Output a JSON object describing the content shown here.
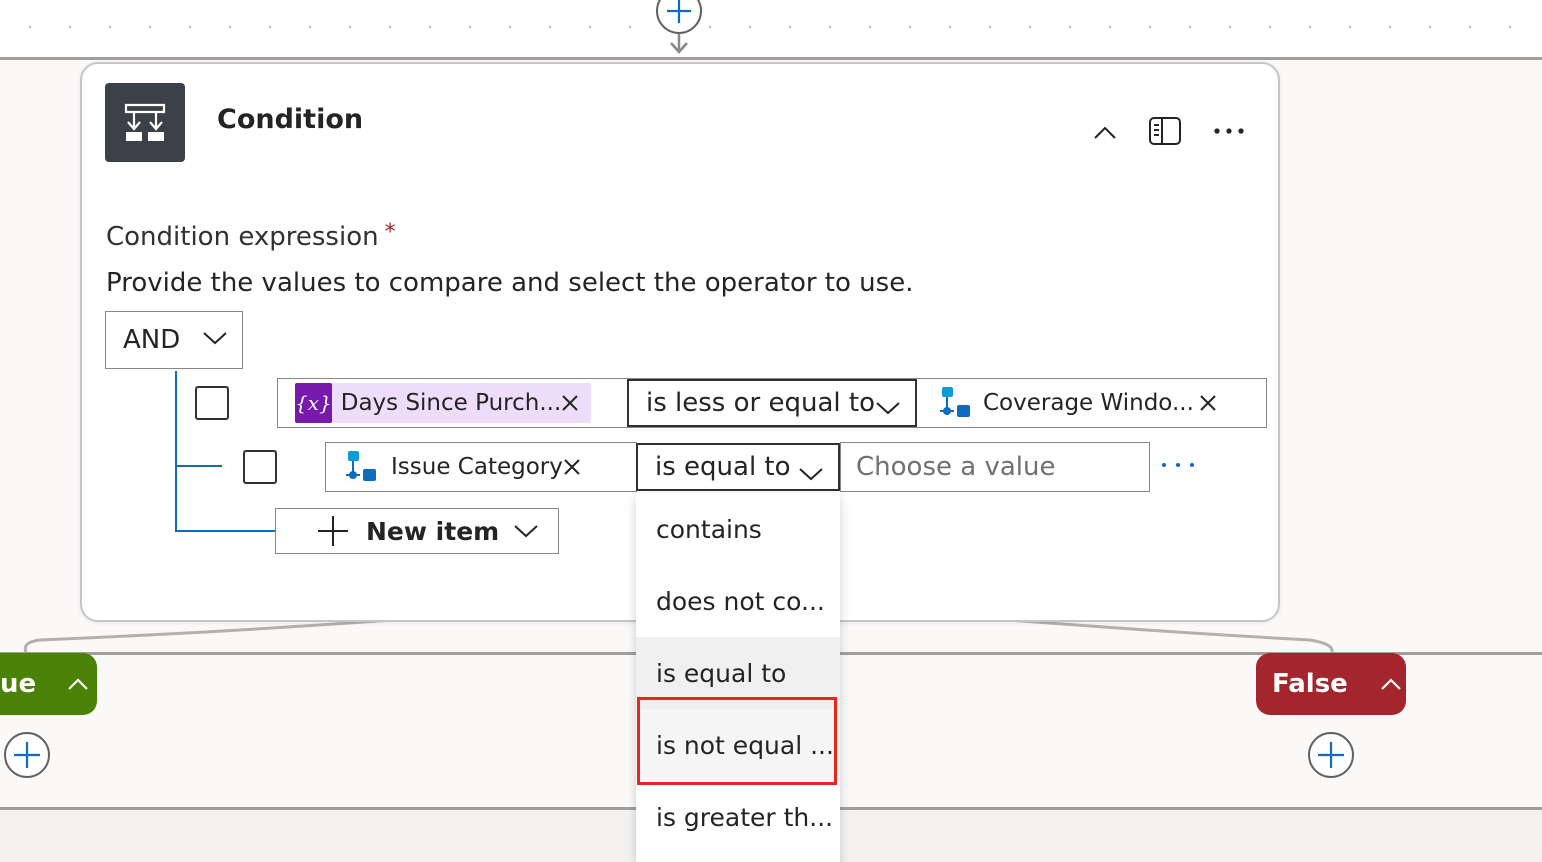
{
  "card": {
    "title": "Condition",
    "collapse_icon": "chevron-up-icon",
    "panel_icon": "side-panel-icon",
    "more_icon": "more-horizontal-icon"
  },
  "condition": {
    "label": "Condition expression",
    "required_mark": "*",
    "description": "Provide the values to compare and select the operator to use.",
    "group_operator": "AND",
    "rows": [
      {
        "left_token": "Days Since Purch...",
        "left_token_type": "variable",
        "left_icon_text": "{x}",
        "operator": "is less or equal to",
        "right_token": "Coverage Windo...",
        "right_token_type": "dynamic-content"
      },
      {
        "left_token": "Issue Category",
        "left_token_type": "dynamic-content",
        "operator": "is equal to",
        "right_placeholder": "Choose a value"
      }
    ],
    "new_item_label": "New item"
  },
  "operator_dropdown": {
    "options": [
      "contains",
      "does not co...",
      "is equal to",
      "is not equal ...",
      "is greater th..."
    ],
    "selected": "is equal to",
    "highlighted": "is not equal ..."
  },
  "branches": {
    "true_label": "ue",
    "false_label": "False"
  },
  "colors": {
    "true_branch": "#498205",
    "false_branch": "#a4262c",
    "variable_chip": "#7719aa",
    "accent": "#0f6cbd",
    "highlight_border": "#e8261c"
  }
}
